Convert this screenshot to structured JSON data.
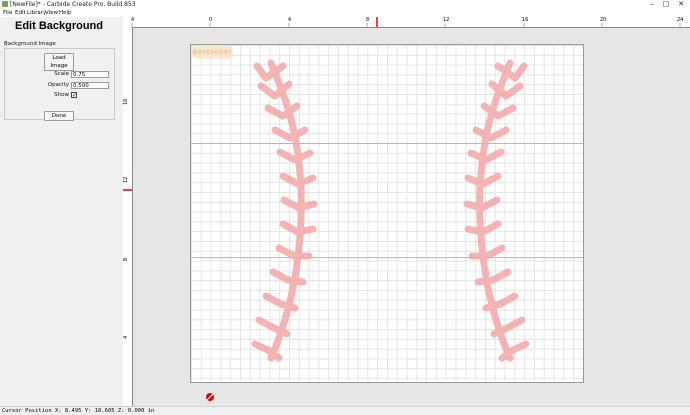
{
  "window": {
    "title": "[NewFile]* - Carbide Create Pro, Build 853",
    "minimize": "–",
    "maximize": "□",
    "close": "✕"
  },
  "menu": {
    "file": "File",
    "edit": "Edit",
    "library": "Library",
    "view": "View",
    "help": "Help"
  },
  "panel": {
    "title": "Edit Background",
    "group_label": "Background Image",
    "load_button": "Load Image",
    "scale_label": "Scale",
    "scale_value": "0.75",
    "opacity_label": "Opacity",
    "opacity_value": "0.500",
    "show_label": "Show",
    "show_checked": "✓",
    "done_button": "Done"
  },
  "rulers": {
    "top": [
      "4",
      "0",
      "4",
      "8",
      "12",
      "16",
      "20",
      "24"
    ],
    "left": [
      "16",
      "12",
      "8",
      "4"
    ]
  },
  "background": {
    "watermark": "Bestseller",
    "stitch_color": "#f4a7a7"
  },
  "status": {
    "cursor": "Cursor Position X: 8.495 Y: 10.605 Z: 0.000 in"
  }
}
